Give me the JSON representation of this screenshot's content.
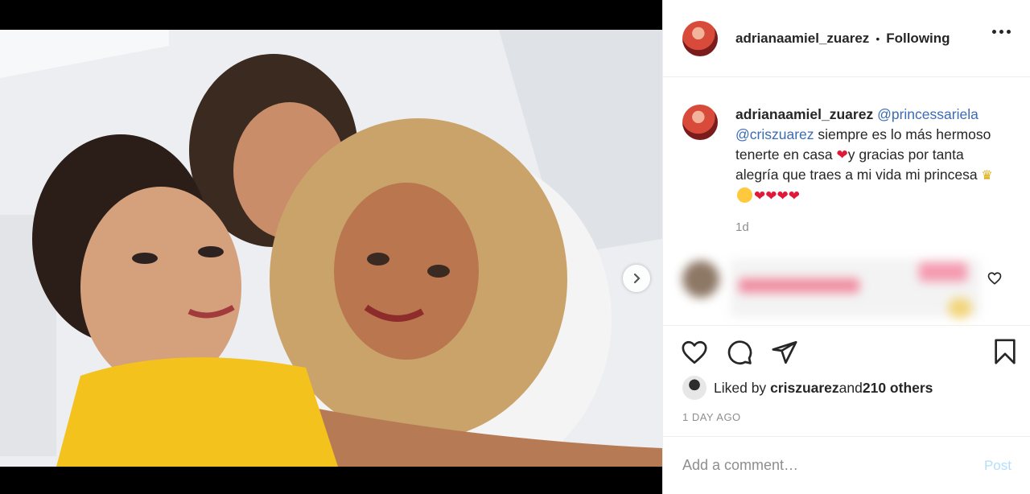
{
  "post": {
    "author": "adrianaamiel_zuarez",
    "follow_status": "Following",
    "bullet": "•"
  },
  "caption": {
    "username": "adrianaamiel_zuarez",
    "mention1": "@princessariela",
    "mention2": "@criszuarez",
    "text1": " siempre es lo más hermoso tenerte en casa ",
    "text2": "y gracias por tanta alegría que traes a mi vida mi princesa ",
    "time_ago": "1d"
  },
  "likes": {
    "prefix": "Liked by ",
    "user": "criszuarez",
    "and": " and ",
    "others": "210 others"
  },
  "date": "1 DAY AGO",
  "comment_box": {
    "placeholder": "Add a comment…",
    "post_label": "Post"
  },
  "carousel": {
    "count": 2,
    "active": 1
  },
  "colors": {
    "text": "#262626",
    "secondary": "#8e8e8e",
    "mention": "#00376b",
    "post_disabled": "#b2dffc",
    "heart": "#e0193a",
    "carousel_active": "#0095f6"
  },
  "icons": [
    "more-icon",
    "heart-icon",
    "comment-icon",
    "share-icon",
    "bookmark-icon",
    "chevron-right-icon",
    "emoji-heart-icon",
    "emoji-crown-icon",
    "emoji-wink-icon"
  ]
}
